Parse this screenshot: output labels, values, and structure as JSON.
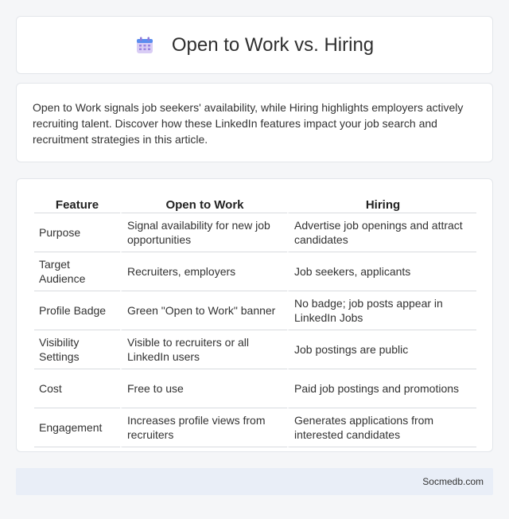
{
  "header": {
    "title": "Open to Work vs. Hiring",
    "icon": "calendar-icon"
  },
  "intro": {
    "text": "Open to Work signals job seekers' availability, while Hiring highlights employers actively recruiting talent. Discover how these LinkedIn features impact your job search and recruitment strategies in this article."
  },
  "table": {
    "headers": [
      "Feature",
      "Open to Work",
      "Hiring"
    ],
    "rows": [
      [
        "Purpose",
        "Signal availability for new job opportunities",
        "Advertise job openings and attract candidates"
      ],
      [
        "Target Audience",
        "Recruiters, employers",
        "Job seekers, applicants"
      ],
      [
        "Profile Badge",
        "Green \"Open to Work\" banner",
        "No badge; job posts appear in LinkedIn Jobs"
      ],
      [
        "Visibility Settings",
        "Visible to recruiters or all LinkedIn users",
        "Job postings are public"
      ],
      [
        "Cost",
        "Free to use",
        "Paid job postings and promotions"
      ],
      [
        "Engagement",
        "Increases profile views from recruiters",
        "Generates applications from interested candidates"
      ]
    ]
  },
  "footer": {
    "source": "Socmedb.com"
  }
}
